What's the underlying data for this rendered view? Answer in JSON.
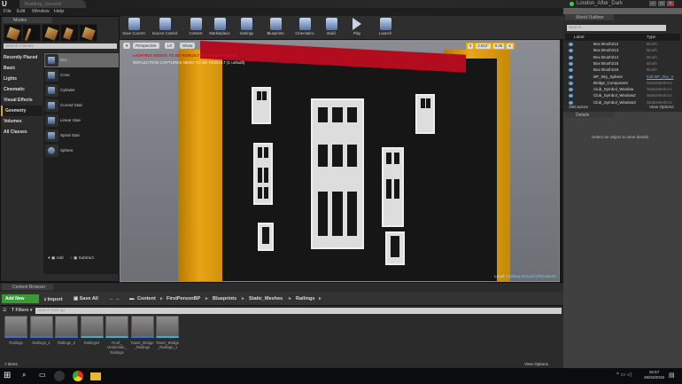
{
  "window": {
    "doc_tab": "Building_Ground",
    "project": "London_After_Dark",
    "min": "–",
    "max": "□",
    "close": "×"
  },
  "menu": [
    "File",
    "Edit",
    "Window",
    "Help"
  ],
  "modes": {
    "tab": "Modes",
    "search_placeholder": "Search Classes",
    "categories": [
      "Recently Placed",
      "Basic",
      "Lights",
      "Cinematic",
      "Visual Effects",
      "Geometry",
      "Volumes",
      "All Classes"
    ],
    "selected_category": "Geometry",
    "items": [
      "Box",
      "Cone",
      "Cylinder",
      "Curved Stair",
      "Linear Stair",
      "Spiral Stair",
      "Sphere"
    ],
    "add": "Add",
    "subtract": "Subtract"
  },
  "toolbar": [
    "Save Current",
    "Source Control",
    "Content",
    "Marketplace",
    "Settings",
    "Blueprints",
    "Cinematics",
    "Build",
    "Play",
    "Launch"
  ],
  "viewport": {
    "perspective": "Perspective",
    "lit": "Lit",
    "show": "Show",
    "warning1": "LIGHTING NEEDS TO BE REBUILT (52 unbuilt objects)",
    "warning2": "REFLECTION CAPTURES NEED TO BE REBUILT (1 unbuilt)",
    "grid": "5",
    "angle": "2.812°",
    "scale": "0.25",
    "camera_speed": "4",
    "level_label": "Level:",
    "level_name": "Building Ground (Persistent)"
  },
  "outliner": {
    "tab": "World Outliner",
    "search_placeholder": "Search...",
    "col_label": "Label",
    "col_type": "Type",
    "rows": [
      {
        "name": "Box Brush212",
        "type": "Brush"
      },
      {
        "name": "Box Brush213",
        "type": "Brush"
      },
      {
        "name": "Box Brush214",
        "type": "Brush"
      },
      {
        "name": "Box Brush215",
        "type": "Brush"
      },
      {
        "name": "Box Brush216",
        "type": "Brush"
      },
      {
        "name": "BP_Sky_Sphere",
        "type": "Edit BP_Sky_S"
      },
      {
        "name": "Bridge_Component",
        "type": "StaticMeshAct"
      },
      {
        "name": "Club_Symbol_Window",
        "type": "StaticMeshAct"
      },
      {
        "name": "Club_Symbol_Window2",
        "type": "StaticMeshAct"
      },
      {
        "name": "Club_Symbol_Window3",
        "type": "StaticMeshAct"
      }
    ],
    "count": "348 actors",
    "view_options": "View Options"
  },
  "details": {
    "tab": "Details",
    "empty": "Select an object to view details",
    "view_options": "View Options"
  },
  "content_browser": {
    "tab": "Content Browser",
    "add_new": "Add New",
    "import": "Import",
    "save_all": "Save All",
    "breadcrumb": [
      "Content",
      "FirstPersonBP",
      "Blueprints",
      "Static_Meshes",
      "Railings"
    ],
    "filters": "Filters",
    "search_placeholder": "Search Railings",
    "assets": [
      "Railings",
      "Railings_1",
      "Railings_2",
      "Railings2",
      "Roof_ Underside_ Railings",
      "Tower_Bridge _Railings",
      "Tower_Bridge _Railings_1"
    ],
    "count": "7 items",
    "view_options": "View Options"
  },
  "taskbar": {
    "time": "15:57",
    "date": "26/03/2019"
  }
}
